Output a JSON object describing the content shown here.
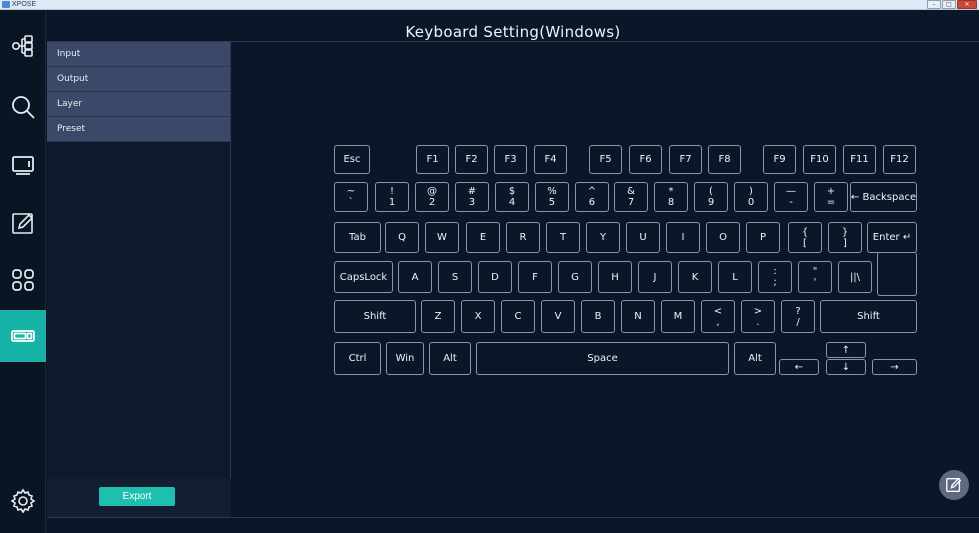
{
  "app": {
    "name": "XPOSE"
  },
  "window_buttons": [
    "–",
    "□",
    "✕"
  ],
  "title": "Keyboard Setting(Windows)",
  "nav": [
    {
      "icon": "signal-routing-icon",
      "active": false
    },
    {
      "icon": "search-icon",
      "active": false
    },
    {
      "icon": "monitor-icon",
      "active": false
    },
    {
      "icon": "edit-pencil-icon",
      "active": false
    },
    {
      "icon": "apps-grid-icon",
      "active": false
    },
    {
      "icon": "keyboard-icon",
      "active": true
    },
    {
      "icon": "settings-gear-icon",
      "active": false
    }
  ],
  "categories": [
    "Input",
    "Output",
    "Layer",
    "Preset"
  ],
  "export_label": "Export",
  "accent_color": "#17b3a6",
  "keyboard": {
    "row_fn": [
      "Esc",
      "F1",
      "F2",
      "F3",
      "F4",
      "F5",
      "F6",
      "F7",
      "F8",
      "F9",
      "F10",
      "F11",
      "F12"
    ],
    "row_num": [
      [
        "~",
        "`"
      ],
      [
        "!",
        "1"
      ],
      [
        "@",
        "2"
      ],
      [
        "#",
        "3"
      ],
      [
        "$",
        "4"
      ],
      [
        "%",
        "5"
      ],
      [
        "^",
        "6"
      ],
      [
        "&",
        "7"
      ],
      [
        "*",
        "8"
      ],
      [
        "(",
        "9"
      ],
      [
        ")",
        "0"
      ],
      [
        "—",
        "-"
      ],
      [
        "+",
        "="
      ],
      [
        "← Backspace",
        ""
      ]
    ],
    "row_q": [
      "Tab",
      "Q",
      "W",
      "E",
      "R",
      "T",
      "Y",
      "U",
      "I",
      "O",
      "P",
      "{|[",
      "}|]",
      "Enter ↵"
    ],
    "row_a": [
      "CapsLock",
      "A",
      "S",
      "D",
      "F",
      "G",
      "H",
      "J",
      "K",
      "L",
      ":|;",
      "\"|'",
      "||\\"
    ],
    "row_z": [
      "Shift",
      "Z",
      "X",
      "C",
      "V",
      "B",
      "N",
      "M",
      "<|,",
      ">|.",
      "?|/",
      "Shift"
    ],
    "row_ctrl": [
      "Ctrl",
      "Win",
      "Alt",
      "Space",
      "Alt"
    ],
    "arrows": [
      "↑",
      "←",
      "↓",
      "→"
    ]
  }
}
